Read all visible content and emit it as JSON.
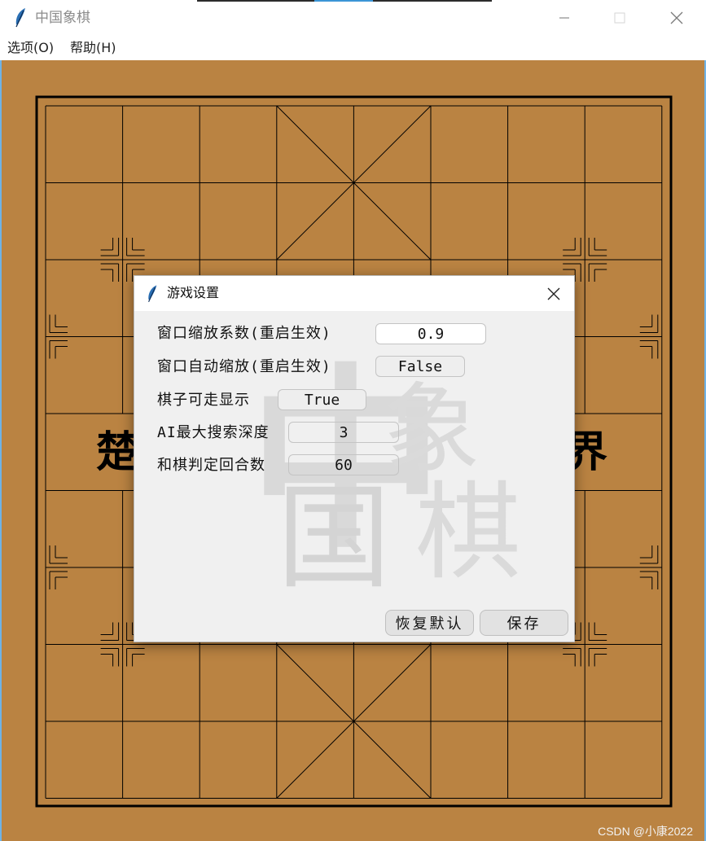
{
  "window": {
    "title": "中国象棋",
    "icon": "feather-icon",
    "controls": [
      "minimize-icon",
      "maximize-icon",
      "close-icon"
    ]
  },
  "menu": {
    "items": [
      {
        "label": "选项(O)"
      },
      {
        "label": "帮助(H)"
      }
    ]
  },
  "board": {
    "river_left": "楚",
    "river_right": "界",
    "background_color": "#ba8342",
    "line_color": "#000000"
  },
  "dialog": {
    "title": "游戏设置",
    "rows": [
      {
        "label": "窗口缩放系数(重启生效)",
        "value": "0.9"
      },
      {
        "label": "窗口自动缩放(重启生效)",
        "value": "False"
      },
      {
        "label": "棋子可走显示",
        "value": "True"
      },
      {
        "label": "AI最大搜索深度",
        "value": "3"
      },
      {
        "label": "和棋判定回合数",
        "value": "60"
      }
    ],
    "logo": {
      "chars": [
        "中",
        "国",
        "象",
        "棋"
      ]
    },
    "buttons": {
      "reset": "恢复默认",
      "save": "保存"
    }
  },
  "watermark": "CSDN @小康2022"
}
